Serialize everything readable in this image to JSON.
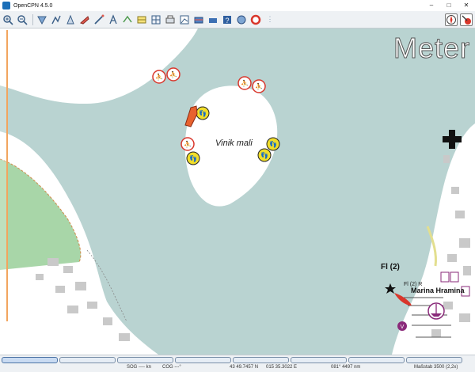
{
  "window": {
    "title": "OpenCPN 4.5.0"
  },
  "toolbar": {
    "tools": [
      "zoom-in-icon",
      "zoom-out-icon",
      "route-icon",
      "waypoint-icon",
      "track-icon",
      "ais-icon",
      "measure-icon",
      "text-icon",
      "layers-icon",
      "settings-icon",
      "print-icon",
      "chart-icon",
      "dashboard-icon",
      "anchor-icon",
      "help-icon",
      "globe-icon",
      "lifebuoy-icon"
    ]
  },
  "map": {
    "scale_unit": "Meter",
    "island_name": "Vinik mali",
    "light_char": "Fl (2)",
    "light_char_small": "Fl (2) R",
    "marina_name": "Marina Hramina"
  },
  "status": {
    "sog": "SOG ---- kn",
    "cog": "COG ---°",
    "lat": "43 49.7457 N",
    "lon": "015 35.3022 E",
    "bearing": "081°  4497 nm",
    "scale": "Maßstab 3500 (2,2x)"
  },
  "colors": {
    "water": "#b9d3d1",
    "land": "#ffffff",
    "vegetation": "#a8d6a8",
    "marker": "#1e3f8a"
  }
}
